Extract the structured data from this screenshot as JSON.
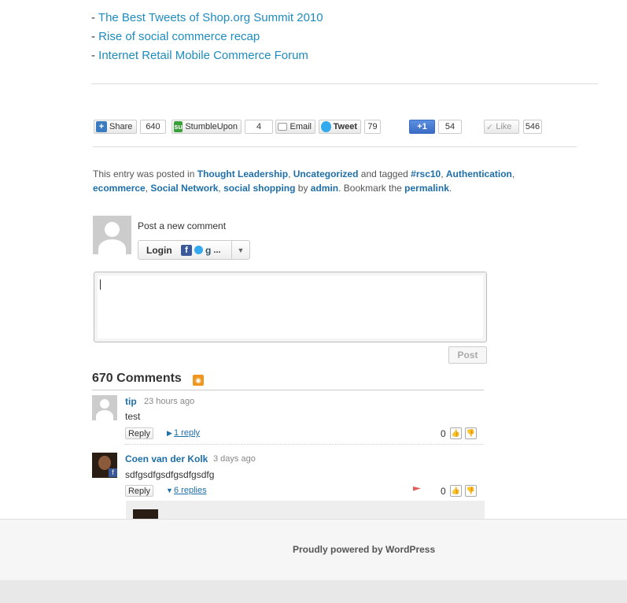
{
  "related_links": [
    {
      "prefix": "- ",
      "label": "The Best Tweets of Shop.org Summit 2010"
    },
    {
      "prefix": "- ",
      "label": "Rise of social commerce recap"
    },
    {
      "prefix": "- ",
      "label": "Internet Retail Mobile Commerce Forum"
    }
  ],
  "share": {
    "share_label": "Share",
    "share_count": "640",
    "stumble_label": "StumbleUpon",
    "stumble_count": "4",
    "email_label": "Email",
    "tweet_label": "Tweet",
    "tweet_count": "79",
    "plusone_label": "+1",
    "plusone_count": "54",
    "like_label": "Like",
    "like_count": "546"
  },
  "entry_meta": {
    "t1": "This entry was posted in ",
    "cat1": "Thought Leadership",
    "t2": ", ",
    "cat2": "Uncategorized",
    "t3": " and tagged ",
    "tag1": "#rsc10",
    "t4": ", ",
    "tag2": "Authentication",
    "t5": ", ",
    "tag3": "ecommerce",
    "t6": ", ",
    "tag4": "Social Network",
    "t7": ", ",
    "tag5": "social shopping",
    "t8": " by ",
    "author": "admin",
    "t9": ". Bookmark the ",
    "permalink": "permalink",
    "t10": "."
  },
  "comment_form": {
    "post_new_label": "Post a new comment",
    "login_label": "Login",
    "login_more": "...",
    "post_button": "Post",
    "icons": [
      "facebook-icon",
      "twitter-icon",
      "google-icon"
    ]
  },
  "comments_header": {
    "title": "670 Comments"
  },
  "comments": [
    {
      "author": "tip",
      "time": "23 hours ago",
      "text": "test",
      "reply": "Reply",
      "replies": "1 reply",
      "votes": "0"
    },
    {
      "author": "Coen van der Kolk",
      "time": "3 days ago",
      "text": "sdfgsdfgsdfgsdfgsdfg",
      "reply": "Reply",
      "replies": "6 replies",
      "votes": "0"
    }
  ],
  "footer": {
    "text": "Proudly powered by WordPress"
  },
  "colors": {
    "link": "#1e8cbe",
    "meta_link": "#1e6fa8",
    "rss": "#f0961e"
  }
}
